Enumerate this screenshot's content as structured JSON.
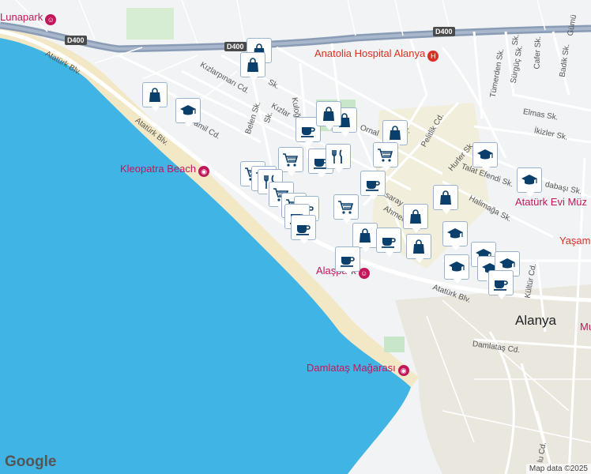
{
  "map": {
    "attribution": "Map data ©2025",
    "logo": "Google",
    "city_label": "Alanya",
    "colors": {
      "sea": "#3fb4e5",
      "land": "#f1f3f4",
      "beach": "#f3e8c6",
      "park": "#c8e6c9",
      "road": "#ffffff",
      "highway": "#8a9bb5",
      "marker_icon": "#0b3f6b",
      "poi": "#c2185b"
    }
  },
  "pois": [
    {
      "id": "lunapark",
      "label": "Lunapark",
      "style": "pink"
    },
    {
      "id": "anatolia-hospital",
      "label": "Anatolia Hospital Alanya",
      "style": "red"
    },
    {
      "id": "kleopatra-beach",
      "label": "Kleopatra Beach",
      "style": "pink"
    },
    {
      "id": "alanya-park",
      "label": "Alaşpark",
      "style": "pink"
    },
    {
      "id": "damlatas",
      "label": "Damlataş Mağarası",
      "style": "pink"
    },
    {
      "id": "ataturk-evi",
      "label": "Atatürk Evi Müz",
      "style": "pink"
    },
    {
      "id": "yasam",
      "label": "Yaşam",
      "style": "red"
    },
    {
      "id": "mu",
      "label": "Mu",
      "style": "pink"
    }
  ],
  "roads": [
    {
      "id": "d400-1",
      "label": "D400",
      "kind": "shield"
    },
    {
      "id": "d400-2",
      "label": "D400",
      "kind": "shield"
    },
    {
      "id": "d400-3",
      "label": "D400",
      "kind": "shield"
    },
    {
      "id": "ataturk-blv-1",
      "label": "Atatürk Blv."
    },
    {
      "id": "ataturk-blv-2",
      "label": "Atatürk Blv."
    },
    {
      "id": "ataturk-blv-3",
      "label": "Atatürk Blv."
    },
    {
      "id": "kizlarpinari",
      "label": "Kızlarpınarı Cd."
    },
    {
      "id": "kizlar",
      "label": "Kızlar"
    },
    {
      "id": "hamil",
      "label": "amil Cd."
    },
    {
      "id": "belen",
      "label": "Belen Sk."
    },
    {
      "id": "kuloglu",
      "label": "Kuloğlu Sk."
    },
    {
      "id": "pelitlik",
      "label": "Pelitlik Cd."
    },
    {
      "id": "ornali",
      "label": "Ornal"
    },
    {
      "id": "tumerden",
      "label": "Tümerden Sk."
    },
    {
      "id": "surguc",
      "label": "Sürgüç Sk."
    },
    {
      "id": "cafer",
      "label": "Cafer Sk."
    },
    {
      "id": "badik",
      "label": "Badik Sk."
    },
    {
      "id": "elmas",
      "label": "Elmas Sk."
    },
    {
      "id": "ikizler",
      "label": "İkizler Sk."
    },
    {
      "id": "hurler",
      "label": "Hurler Sk."
    },
    {
      "id": "talat",
      "label": "Talat Efendi Sk."
    },
    {
      "id": "halimaga",
      "label": "Halimağa Sk."
    },
    {
      "id": "adabasi",
      "label": "dabaşı Sk."
    },
    {
      "id": "ahmet",
      "label": "Ahmet Yese"
    },
    {
      "id": "atasaray",
      "label": "atasaray"
    },
    {
      "id": "kultur",
      "label": "Kültür Cd."
    },
    {
      "id": "damlatas-cd",
      "label": "Damlataş Cd."
    },
    {
      "id": "gumus",
      "label": "Gümü"
    },
    {
      "id": "lu-cd",
      "label": "lu Cd."
    },
    {
      "id": "sk1",
      "label": "Sk."
    },
    {
      "id": "sk2",
      "label": "Sk."
    },
    {
      "id": "sk3",
      "label": "Sk."
    },
    {
      "id": "sk4",
      "label": "Sk."
    }
  ],
  "markers": [
    {
      "type": "shopping-bag"
    },
    {
      "type": "shopping-bag"
    },
    {
      "type": "school"
    },
    {
      "type": "shopping-bag"
    },
    {
      "type": "cafe"
    },
    {
      "type": "shopping-bag"
    },
    {
      "type": "shopping-bag"
    },
    {
      "type": "shopping-bag"
    },
    {
      "type": "shopping-cart"
    },
    {
      "type": "shopping-cart"
    },
    {
      "type": "cafe"
    },
    {
      "type": "restaurant"
    },
    {
      "type": "shopping-cart"
    },
    {
      "type": "shopping-cart"
    },
    {
      "type": "restaurant"
    },
    {
      "type": "shopping-cart"
    },
    {
      "type": "shopping-cart"
    },
    {
      "type": "cafe"
    },
    {
      "type": "cafe"
    },
    {
      "type": "cafe"
    },
    {
      "type": "shopping-bag"
    },
    {
      "type": "cafe"
    },
    {
      "type": "shopping-bag"
    },
    {
      "type": "shopping-bag"
    },
    {
      "type": "cafe"
    },
    {
      "type": "cafe"
    },
    {
      "type": "shopping-bag"
    },
    {
      "type": "school"
    },
    {
      "type": "school"
    },
    {
      "type": "school"
    },
    {
      "type": "school"
    },
    {
      "type": "school"
    },
    {
      "type": "school"
    },
    {
      "type": "school"
    },
    {
      "type": "cafe"
    },
    {
      "type": "shopping-cart"
    }
  ]
}
